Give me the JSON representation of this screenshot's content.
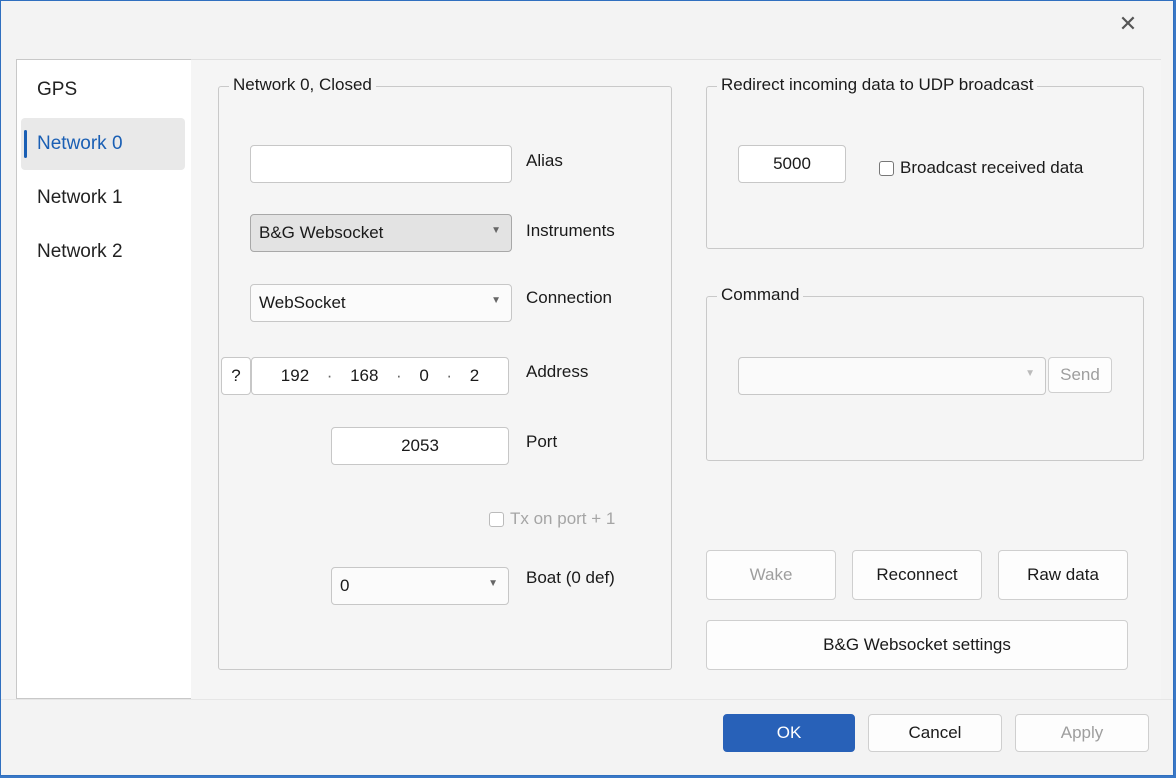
{
  "window": {
    "close_glyph": "✕"
  },
  "sidebar": {
    "items": [
      {
        "label": "GPS"
      },
      {
        "label": "Network 0"
      },
      {
        "label": "Network 1"
      },
      {
        "label": "Network 2"
      }
    ],
    "selected_index": 1
  },
  "network_group": {
    "title": "Network 0, Closed",
    "alias": {
      "label": "Alias",
      "value": ""
    },
    "instruments": {
      "label": "Instruments",
      "value": "B&G Websocket"
    },
    "connection": {
      "label": "Connection",
      "value": "WebSocket"
    },
    "address": {
      "label": "Address",
      "help": "?",
      "octets": [
        "192",
        "168",
        "0",
        "2"
      ]
    },
    "port": {
      "label": "Port",
      "value": "2053"
    },
    "tx_port": {
      "label": "Tx on port + 1",
      "checked": false,
      "enabled": false
    },
    "boat": {
      "label": "Boat (0 def)",
      "value": "0"
    }
  },
  "redirect_group": {
    "title": "Redirect incoming data to UDP broadcast",
    "port_value": "5000",
    "broadcast": {
      "label": "Broadcast received data",
      "checked": false
    }
  },
  "command_group": {
    "title": "Command",
    "value": "",
    "send_label": "Send"
  },
  "actions": {
    "wake": "Wake",
    "reconnect": "Reconnect",
    "raw_data": "Raw data",
    "settings": "B&G Websocket settings"
  },
  "footer": {
    "ok": "OK",
    "cancel": "Cancel",
    "apply": "Apply"
  },
  "colors": {
    "accent": "#1a5fb4",
    "primary_button": "#2861b8"
  }
}
